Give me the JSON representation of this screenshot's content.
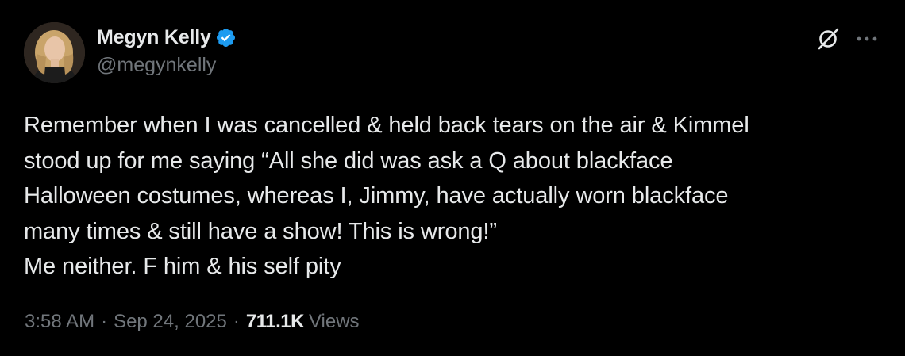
{
  "author": {
    "display_name": "Megyn Kelly",
    "handle": "@megynkelly",
    "verified": true,
    "verified_color": "#1d9bf0"
  },
  "actions": {
    "grok_icon": "grok-icon",
    "more_icon": "more-horizontal-icon"
  },
  "tweet": {
    "lines": [
      "Remember when I was cancelled & held back tears on the air & Kimmel",
      "stood up for me saying “All she did was ask a Q about blackface",
      "Halloween costumes, whereas I, Jimmy, have actually worn blackface",
      "many times & still have a show! This is wrong!”",
      "Me neither. F him & his self pity"
    ]
  },
  "meta": {
    "time": "3:58 AM",
    "separator": "·",
    "date": "Sep 24, 2025",
    "views_count": "711.1K",
    "views_label": "Views"
  },
  "colors": {
    "background": "#000000",
    "primary_text": "#e7e9ea",
    "secondary_text": "#71767b"
  }
}
